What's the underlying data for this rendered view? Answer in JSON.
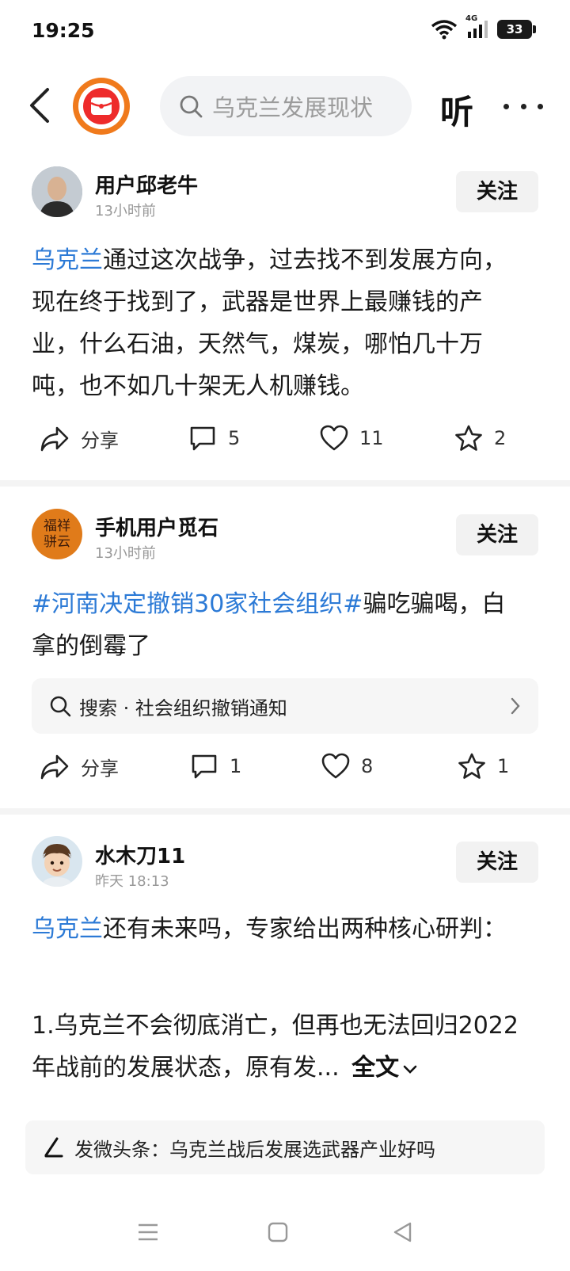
{
  "status_bar": {
    "time": "19:25",
    "network": "4G",
    "battery": "33"
  },
  "header": {
    "search_placeholder": "乌克兰发展现状",
    "listen_label": "听"
  },
  "posts": [
    {
      "username": "用户邱老牛",
      "time": "13小时前",
      "follow_label": "关注",
      "link_text": "乌克兰",
      "body": "通过这次战争，过去找不到发展方向，现在终于找到了，武器是世界上最赚钱的产业，什么石油，天然气，煤炭，哪怕几十万吨，也不如几十架无人机赚钱。",
      "share_label": "分享",
      "comments": "5",
      "likes": "11",
      "favorites": "2"
    },
    {
      "username": "手机用户觅石",
      "time": "13小时前",
      "follow_label": "关注",
      "avatar_text": "福祥骈云",
      "link_text": "#河南决定撤销30家社会组织#",
      "body": "骗吃骗喝，白拿的倒霉了",
      "search_card": "搜索 · 社会组织撤销通知",
      "share_label": "分享",
      "comments": "1",
      "likes": "8",
      "favorites": "1"
    },
    {
      "username": "水木刀11",
      "time": "昨天  18:13",
      "follow_label": "关注",
      "link_text": "乌克兰",
      "body": "还有未来吗，专家给出两种核心研判：",
      "body_2": "1.乌克兰不会彻底消亡，但再也无法回归2022年战前的发展状态，原有发...",
      "full_text_label": "全文",
      "topic": "发微头条：乌克兰战后发展选武器产业好吗"
    }
  ],
  "colors": {
    "link": "#2c7ad6",
    "logo_orange": "#f07a1c",
    "logo_red": "#ee2b2b"
  }
}
